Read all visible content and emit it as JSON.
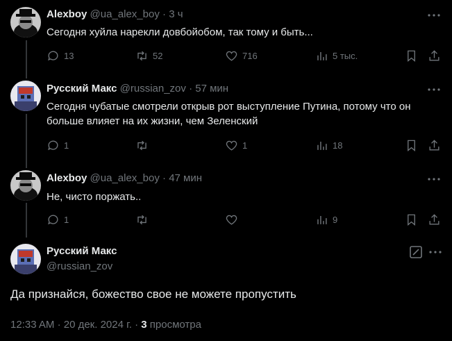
{
  "replies": [
    {
      "author": "Alexboy",
      "handle": "@ua_alex_boy",
      "time": "3 ч",
      "text": "Сегодня хуйла нарекли довбойобом, так тому и быть...",
      "stats": {
        "replies": "13",
        "reposts": "52",
        "likes": "716",
        "views": "5 тыс."
      },
      "avatar_icon": "man-with-hat-avatar"
    },
    {
      "author": "Русский Макс",
      "handle": "@russian_zov",
      "time": "57 мин",
      "text": "Сегодня чубатые смотрели открыв рот  выступление Путина, потому что он больше влияет на их жизни, чем Зеленский",
      "stats": {
        "replies": "1",
        "reposts": "",
        "likes": "1",
        "views": "18"
      },
      "avatar_icon": "pixel-character-avatar"
    },
    {
      "author": "Alexboy",
      "handle": "@ua_alex_boy",
      "time": "47 мин",
      "text": "Не, чисто поржать..",
      "stats": {
        "replies": "1",
        "reposts": "",
        "likes": "",
        "views": "9"
      },
      "avatar_icon": "man-with-hat-avatar"
    }
  ],
  "main_tweet": {
    "author": "Русский Макс",
    "handle": "@russian_zov",
    "text": "Да признайся, божество свое не можете пропустить",
    "time": "12:33 AM",
    "date": "20 дек. 2024 г.",
    "views_count": "3",
    "views_label": "просмотра"
  },
  "separator": "·",
  "colors": {
    "background": "#000000",
    "text": "#e7e9ea",
    "secondary": "#71767b"
  }
}
